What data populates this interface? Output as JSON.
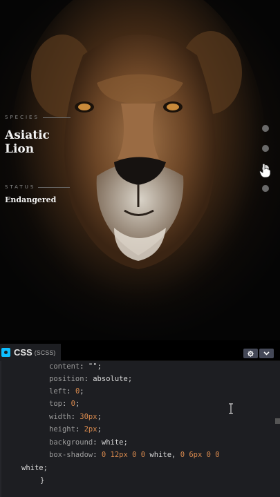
{
  "preview": {
    "species_label": "SPECIES",
    "species_name": "Asiatic Lion",
    "status_label": "STATUS",
    "status_value": "Endangered",
    "nav_dots": [
      {
        "name": "nav-dot-1",
        "active": false
      },
      {
        "name": "nav-dot-2",
        "active": false
      },
      {
        "name": "nav-dot-3",
        "active": true
      },
      {
        "name": "nav-dot-4",
        "active": false
      }
    ]
  },
  "editor": {
    "tab_title": "CSS",
    "tab_subtitle": "(SCSS)",
    "icons": {
      "tab": "css-icon",
      "settings": "gear-icon",
      "collapse": "chevron-down-icon",
      "pointer": "hand-pointer-icon",
      "text": "text-cursor-icon"
    },
    "lines": {
      "l1_prop": "content",
      "l1_val": "\"\"",
      "l2_prop": "position",
      "l2_val": "absolute",
      "l3_prop": "left",
      "l3_val": "0",
      "l4_prop": "top",
      "l4_val": "0",
      "l5_prop": "width",
      "l5_val": "30px",
      "l6_prop": "height",
      "l6_val": "2px",
      "l7_prop": "background",
      "l7_val": "white",
      "l8_prop": "box-shadow",
      "l8_val_a": "0 12px 0 0",
      "l8_val_b": "white",
      "l8_val_c": "0 6px 0 0",
      "l9_val": "white",
      "l10": "}"
    },
    "colors": {
      "accent": "#0ebeff",
      "number": "#d98a4e",
      "background": "#1d1e22"
    }
  }
}
